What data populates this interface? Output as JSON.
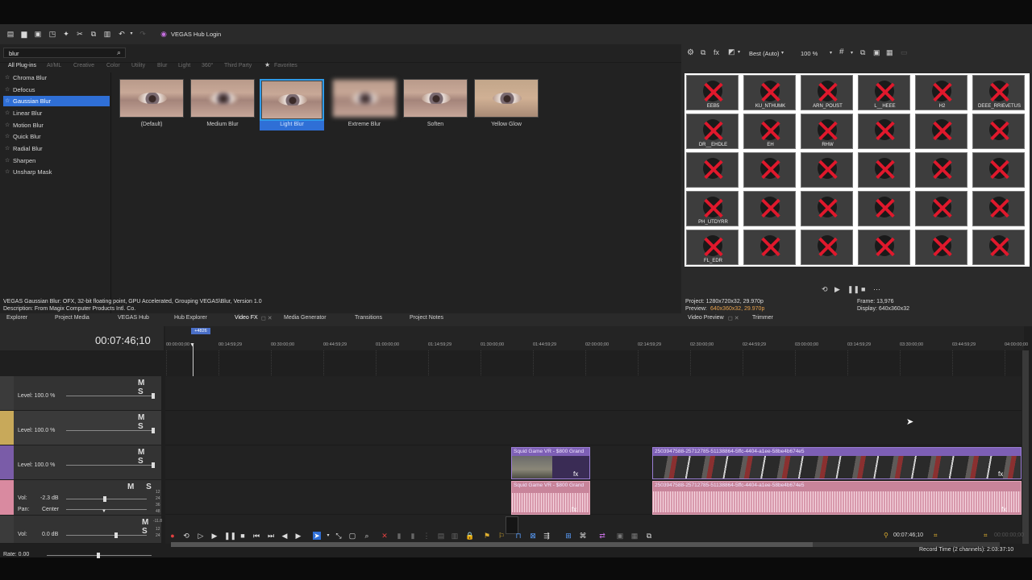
{
  "toolbar": {
    "hub_login": "VEGAS Hub Login"
  },
  "search": {
    "value": "blur"
  },
  "categories": [
    "All Plug-ins",
    "AI/ML",
    "Creative",
    "Color",
    "Utility",
    "Blur",
    "Light",
    "360°",
    "Third Party",
    "Favorites"
  ],
  "effects": [
    "Chroma Blur",
    "Defocus",
    "Gaussian Blur",
    "Linear Blur",
    "Motion Blur",
    "Quick Blur",
    "Radial Blur",
    "Sharpen",
    "Unsharp Mask"
  ],
  "presets": [
    "(Default)",
    "Medium Blur",
    "Light Blur",
    "Extreme Blur",
    "Soften",
    "Yellow Glow"
  ],
  "description": {
    "line1": "VEGAS Gaussian Blur: OFX, 32-bit floating point, GPU Accelerated, Grouping VEGAS\\Blur, Version 1.0",
    "line2": "Description: From Magix Computer Products Intl. Co."
  },
  "left_tabs": [
    "Explorer",
    "Project Media",
    "VEGAS Hub",
    "Hub Explorer",
    "Video FX",
    "Media Generator",
    "Transitions",
    "Project Notes"
  ],
  "preview": {
    "quality": "Best (Auto)",
    "zoom": "100 %",
    "project": "Project:  1280x720x32, 29.970p",
    "preview_lbl": "Preview:",
    "preview_val": "640x360x32, 29.970p",
    "frame": "Frame:      13,976",
    "display": "Display:    640x360x32",
    "tabs": [
      "Video Preview",
      "Trimmer"
    ],
    "names": [
      "EEB5",
      "KU_NTHUMK",
      "ARN_POUST",
      "L__HEEE",
      "H2",
      "DEEE_RRIEvETUS",
      "DR__EHDLE",
      "EH",
      "RHW",
      "",
      "",
      "",
      "",
      "",
      "",
      "",
      "",
      "",
      "PH_UTDYRR",
      "",
      "",
      "",
      "",
      "",
      "FL_EDR",
      "",
      "",
      "",
      "",
      ""
    ]
  },
  "timeline": {
    "timecode": "00:07:46;10",
    "marker": "+4826",
    "ruler": [
      "00:00:00;00",
      "00:14:59;29",
      "00:30:00;00",
      "00:44:59;29",
      "01:00:00;00",
      "01:14:59;29",
      "01:30:00;00",
      "01:44:59;29",
      "02:00:00;00",
      "02:14:59;29",
      "02:30:00;00",
      "02:44:59;29",
      "03:00:00;00",
      "03:14:59;29",
      "03:30:00;00",
      "03:44:59;29",
      "04:00:00;00"
    ],
    "tracks": [
      {
        "level": "Level: 100.0 %",
        "color": "#4a4a4a"
      },
      {
        "level": "Level: 100.0 %",
        "color": "#c8a95a"
      },
      {
        "level": "Level: 100.0 %",
        "color": "#7a5ca8"
      }
    ],
    "audio1": {
      "vol": "Vol:",
      "vol_val": "-2.3 dB",
      "pan": "Pan:",
      "pan_val": "Center",
      "meter": [
        "12",
        "24",
        "36",
        "48"
      ]
    },
    "audio2": {
      "vol": "Vol:",
      "vol_val": "0.0 dB",
      "meter": [
        "-11.8",
        "12",
        "24"
      ]
    },
    "ms": "M S",
    "rate": "Rate: 0.00",
    "clip1": "Squid Game VR - $800 Grand",
    "clip2": "2503947588-25712785-51138864-5ffc-4404-a1ee-58be4b674e5",
    "fx": "fx",
    "cursor_time": "00:07:46;10",
    "end_time": "00:00:00;00",
    "record_time": "Record Time (2 channels): 2:03:37:10"
  }
}
